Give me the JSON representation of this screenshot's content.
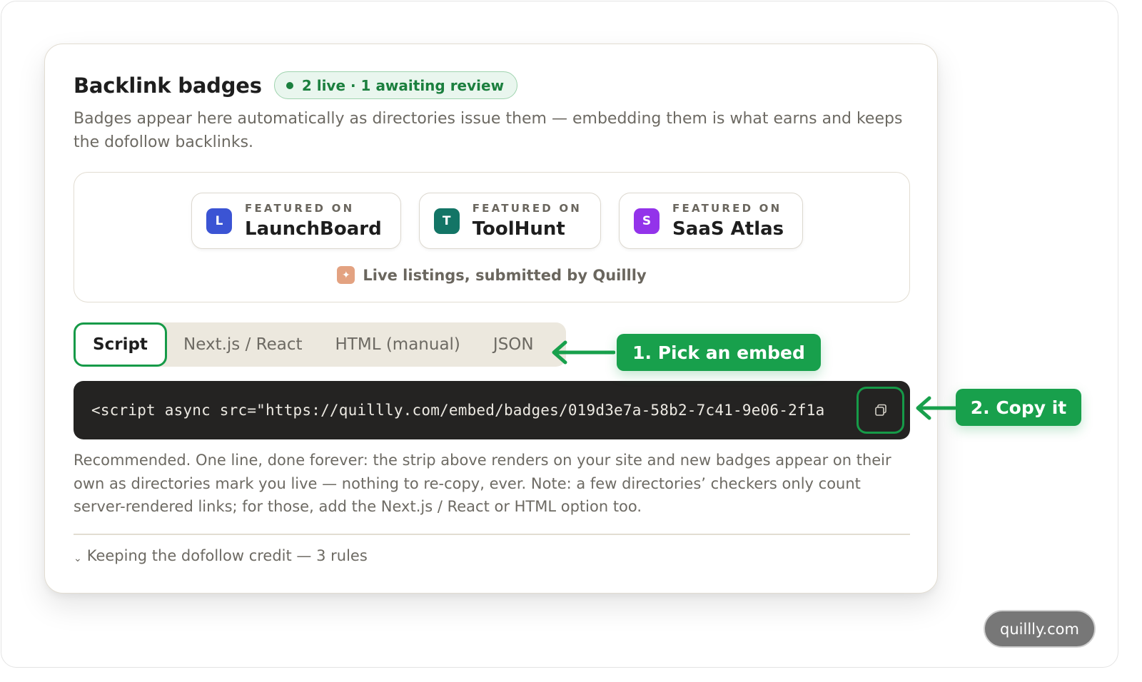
{
  "card": {
    "title": "Backlink badges",
    "status": "2 live · 1 awaiting review",
    "description": "Badges appear here automatically as directories issue them — embedding them is what earns and keeps the dofollow backlinks."
  },
  "preview": {
    "badges": [
      {
        "kicker": "FEATURED ON",
        "name": "LaunchBoard",
        "initial": "L",
        "color": "#3b54d4"
      },
      {
        "kicker": "FEATURED ON",
        "name": "ToolHunt",
        "initial": "T",
        "color": "#137566"
      },
      {
        "kicker": "FEATURED ON",
        "name": "SaaS Atlas",
        "initial": "S",
        "color": "#9333ea"
      }
    ],
    "attribution": "Live listings, submitted by Quillly",
    "attribution_icon": "sparkle-icon"
  },
  "tabs": [
    {
      "label": "Script",
      "active": true
    },
    {
      "label": "Next.js / React",
      "active": false
    },
    {
      "label": "HTML (manual)",
      "active": false
    },
    {
      "label": "JSON",
      "active": false
    }
  ],
  "code": {
    "snippet": "<script async src=\"https://quillly.com/embed/badges/019d3e7a-58b2-7c41-9e06-2f1a",
    "copy_icon": "copy-icon"
  },
  "note": "Recommended. One line, done forever: the strip above renders on your site and new badges appear on their own as directories mark you live — nothing to re-copy, ever. Note: a few directories’ checkers only count server-rendered links; for those, add the Next.js / React or HTML option too.",
  "rules_toggle": "Keeping the dofollow credit — 3 rules",
  "callouts": {
    "step1": "1. Pick an embed",
    "step2": "2. Copy it"
  },
  "site": "quillly.com",
  "colors": {
    "accent": "#169a48",
    "status_text": "#1b7f3e",
    "code_bg": "#242322"
  }
}
